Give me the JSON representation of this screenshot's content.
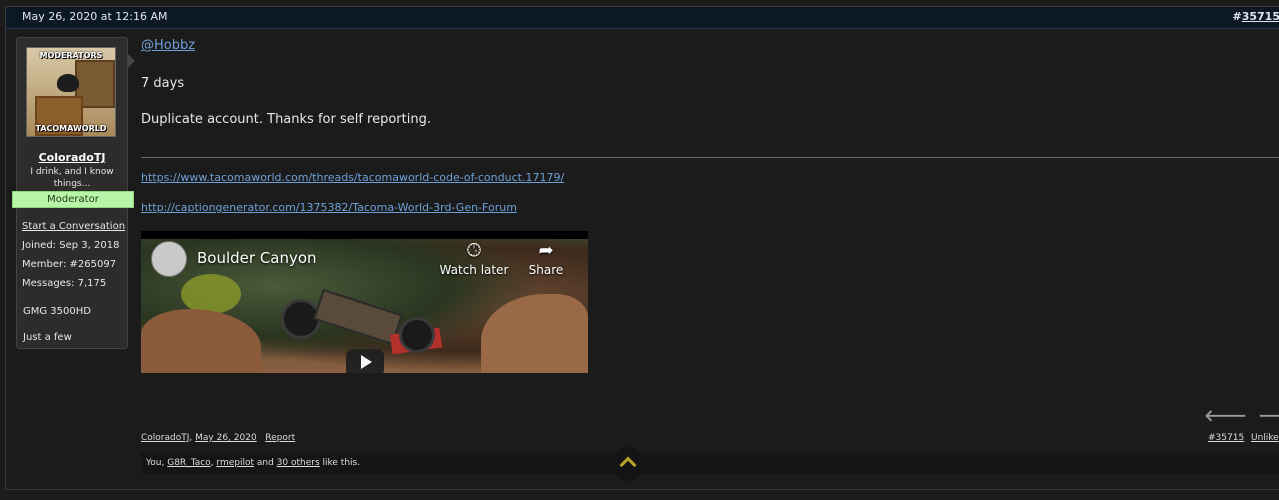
{
  "post": {
    "date": "May 26, 2020 at 12:16 AM",
    "number_prefix": "#",
    "number": "35715"
  },
  "user": {
    "avatar_top_text": "MODERATORS",
    "avatar_bottom_text": "TACOMAWORLD",
    "name": "ColoradoTJ",
    "title": "I drink, and I know things...",
    "role": "Moderator",
    "start_conversation": "Start a Conversation",
    "joined": "Joined: Sep 3, 2018",
    "member": "Member: #265097",
    "messages": "Messages: 7,175",
    "vehicle": "GMG 3500HD",
    "location": "Just a few"
  },
  "message": {
    "mention": "@Hobbz",
    "line1": "7 days",
    "line2": "Duplicate account. Thanks for self reporting.",
    "link1": "https://www.tacomaworld.com/threads/tacomaworld-code-of-conduct.17179/",
    "link2": "http://captiongenerator.com/1375382/Tacoma-World-3rd-Gen-Forum"
  },
  "video": {
    "title": "Boulder Canyon",
    "watch_later": "Watch later",
    "share": "Share",
    "watch_later_icon": "clock-icon",
    "share_icon": "share-arrow-icon"
  },
  "nav": {
    "prev_icon": "arrow-left-icon",
    "next_icon": "arrow-right-icon",
    "prev_glyph": "🡐",
    "next_glyph": "🡒"
  },
  "footer": {
    "author": "ColoradoTJ",
    "separator": ",",
    "date": "May 26, 2020",
    "report": "Report",
    "permalink": "#35715",
    "unlike": "Unlike"
  },
  "likes": {
    "prefix": "You, ",
    "user1": "G8R_Taco",
    "comma": ", ",
    "user2": "rmepilot",
    "and": " and ",
    "others": "30 others",
    "suffix": " like this."
  },
  "colors": {
    "header_bg": "#0d1826",
    "link": "#6ea0d8",
    "moderator_banner": "#b9f5a8",
    "scroll_arrow": "#b8a22a"
  }
}
